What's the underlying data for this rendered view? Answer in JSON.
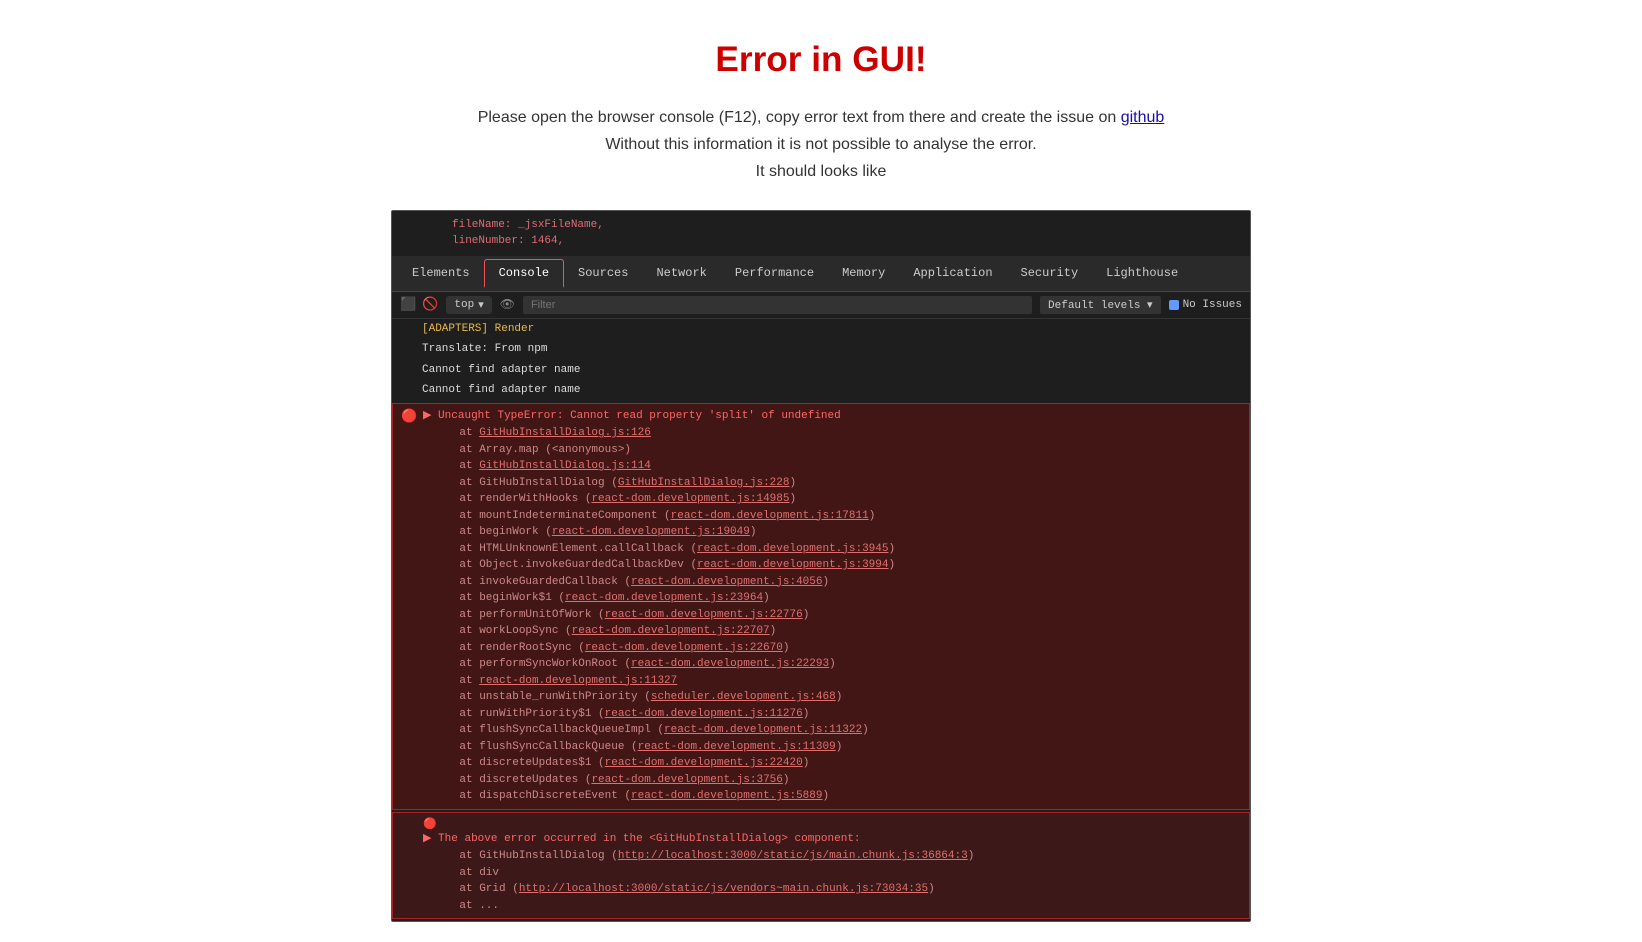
{
  "page": {
    "title": "Error in GUI!",
    "description_line1": "Please open the browser console (F12), copy error text from there and create the issue on ",
    "description_link": "github",
    "description_line2": "Without this information it is not possible to analyse the error.",
    "description_line3": "It should looks like"
  },
  "devtools": {
    "code_snippet": {
      "line1": "fileName: _jsxFileName,",
      "line2": "lineNumber: 1464,"
    },
    "tabs": [
      {
        "label": "Elements",
        "active": false
      },
      {
        "label": "Console",
        "active": true
      },
      {
        "label": "Sources",
        "active": false
      },
      {
        "label": "Network",
        "active": false
      },
      {
        "label": "Performance",
        "active": false
      },
      {
        "label": "Memory",
        "active": false
      },
      {
        "label": "Application",
        "active": false
      },
      {
        "label": "Security",
        "active": false
      },
      {
        "label": "Lighthouse",
        "active": false
      }
    ],
    "filter_bar": {
      "top_label": "top",
      "filter_placeholder": "Filter",
      "levels_label": "Default levels ▾",
      "no_issues_label": "No Issues"
    },
    "console_lines": [
      {
        "text": "[ADAPTERS] Render",
        "type": "yellow"
      },
      {
        "text": "Translate: From npm",
        "type": "white"
      },
      {
        "text": "Cannot find adapter name",
        "type": "white"
      },
      {
        "text": "Cannot find adapter name",
        "type": "white"
      }
    ],
    "error_block1": {
      "main": "▶ Uncaught TypeError: Cannot read property 'split' of undefined",
      "stack": [
        "    at GitHubInstallDialog.js:126",
        "    at Array.map (<anonymous>)",
        "    at GitHubInstallDialog.js:114",
        "    at GitHubInstallDialog (GitHubInstallDialog.js:228)",
        "    at renderWithHooks (react-dom.development.js:14985)",
        "    at mountIndeterminateComponent (react-dom.development.js:17811)",
        "    at beginWork (react-dom.development.js:19049)",
        "    at HTMLUnknownElement.callCallback (react-dom.development.js:3945)",
        "    at Object.invokeGuardedCallbackDev (react-dom.development.js:3994)",
        "    at invokeGuardedCallback (react-dom.development.js:4056)",
        "    at beginWork$1 (react-dom.development.js:23964)",
        "    at performUnitOfWork (react-dom.development.js:22776)",
        "    at workLoopSync (react-dom.development.js:22707)",
        "    at renderRootSync (react-dom.development.js:22670)",
        "    at performSyncWorkOnRoot (react-dom.development.js:22293)",
        "    at react-dom.development.js:11327",
        "    at unstable_runWithPriority (scheduler.development.js:468)",
        "    at runWithPriority$1 (react-dom.development.js:11276)",
        "    at flushSyncCallbackQueueImpl (react-dom.development.js:11322)",
        "    at flushSyncCallbackQueue (react-dom.development.js:11309)",
        "    at discreteUpdates$1 (react-dom.development.js:22420)",
        "    at discreteUpdates (react-dom.development.js:3756)",
        "    at dispatchDiscreteEvent (react-dom.development.js:5889)"
      ]
    },
    "error_block2": {
      "main": "▶ The above error occurred in the <GitHubInstallDialog> component:",
      "stack": [
        "    at GitHubInstallDialog (http://localhost:3000/static/js/main.chunk.js:36864:3)",
        "    at div",
        "    at Grid (http://localhost:3000/static/js/vendors~main.chunk.js:73034:35)",
        "    at ..."
      ]
    }
  }
}
